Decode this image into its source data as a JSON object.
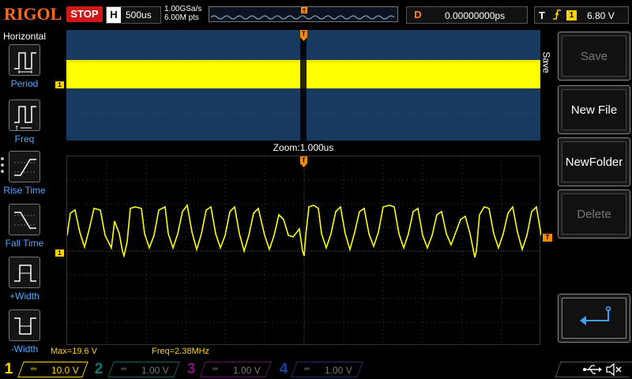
{
  "header": {
    "logo": "RIGOL",
    "run_state": "STOP",
    "timebase_label": "H",
    "timebase_value": "500us",
    "sample_rate": "1.00GSa/s",
    "memory_depth": "6.00M pts",
    "delay_label": "D",
    "delay_value": "0.00000000ps",
    "trigger_label": "T",
    "trigger_edge_icon": "rising-edge-icon",
    "trigger_source": "1",
    "trigger_level": "6.80 V"
  },
  "left_menu": {
    "title": "Horizontal",
    "items": [
      {
        "label": "Period",
        "icon": "period-icon"
      },
      {
        "label": "Freq",
        "icon": "frequency-icon"
      },
      {
        "label": "Rise Time",
        "icon": "rise-time-icon"
      },
      {
        "label": "Fall Time",
        "icon": "fall-time-icon"
      },
      {
        "label": "+Width",
        "icon": "positive-width-icon"
      },
      {
        "label": "-Width",
        "icon": "negative-width-icon"
      }
    ]
  },
  "display": {
    "zoom_label": "Zoom:1.000us",
    "channel_marker": "1",
    "trigger_marker": "T"
  },
  "measurements": {
    "max": "Max=19.6 V",
    "freq": "Freq=2.38MHz"
  },
  "right_menu": {
    "title": "Save",
    "keys": [
      {
        "label": "Save",
        "enabled": false
      },
      {
        "label": "New File",
        "enabled": true
      },
      {
        "label": "NewFolder",
        "enabled": true
      },
      {
        "label": "Delete",
        "enabled": false
      }
    ],
    "enter_icon": "enter-arrow-icon"
  },
  "channels": [
    {
      "num": "1",
      "scale": "10.0 V",
      "color": "#ffd400",
      "active": true
    },
    {
      "num": "2",
      "scale": "1.00 V",
      "color": "#19c6c6",
      "active": false
    },
    {
      "num": "3",
      "scale": "1.00 V",
      "color": "#d21fd2",
      "active": false
    },
    {
      "num": "4",
      "scale": "1.00 V",
      "color": "#2f6bff",
      "active": false
    }
  ],
  "status_icons": [
    "usb-icon",
    "speaker-mute-icon"
  ],
  "colors": {
    "ch1": "#ffd400",
    "trigger": "#ff8a00",
    "stop": "#d01818",
    "main_window_bg": "#173a5e"
  }
}
